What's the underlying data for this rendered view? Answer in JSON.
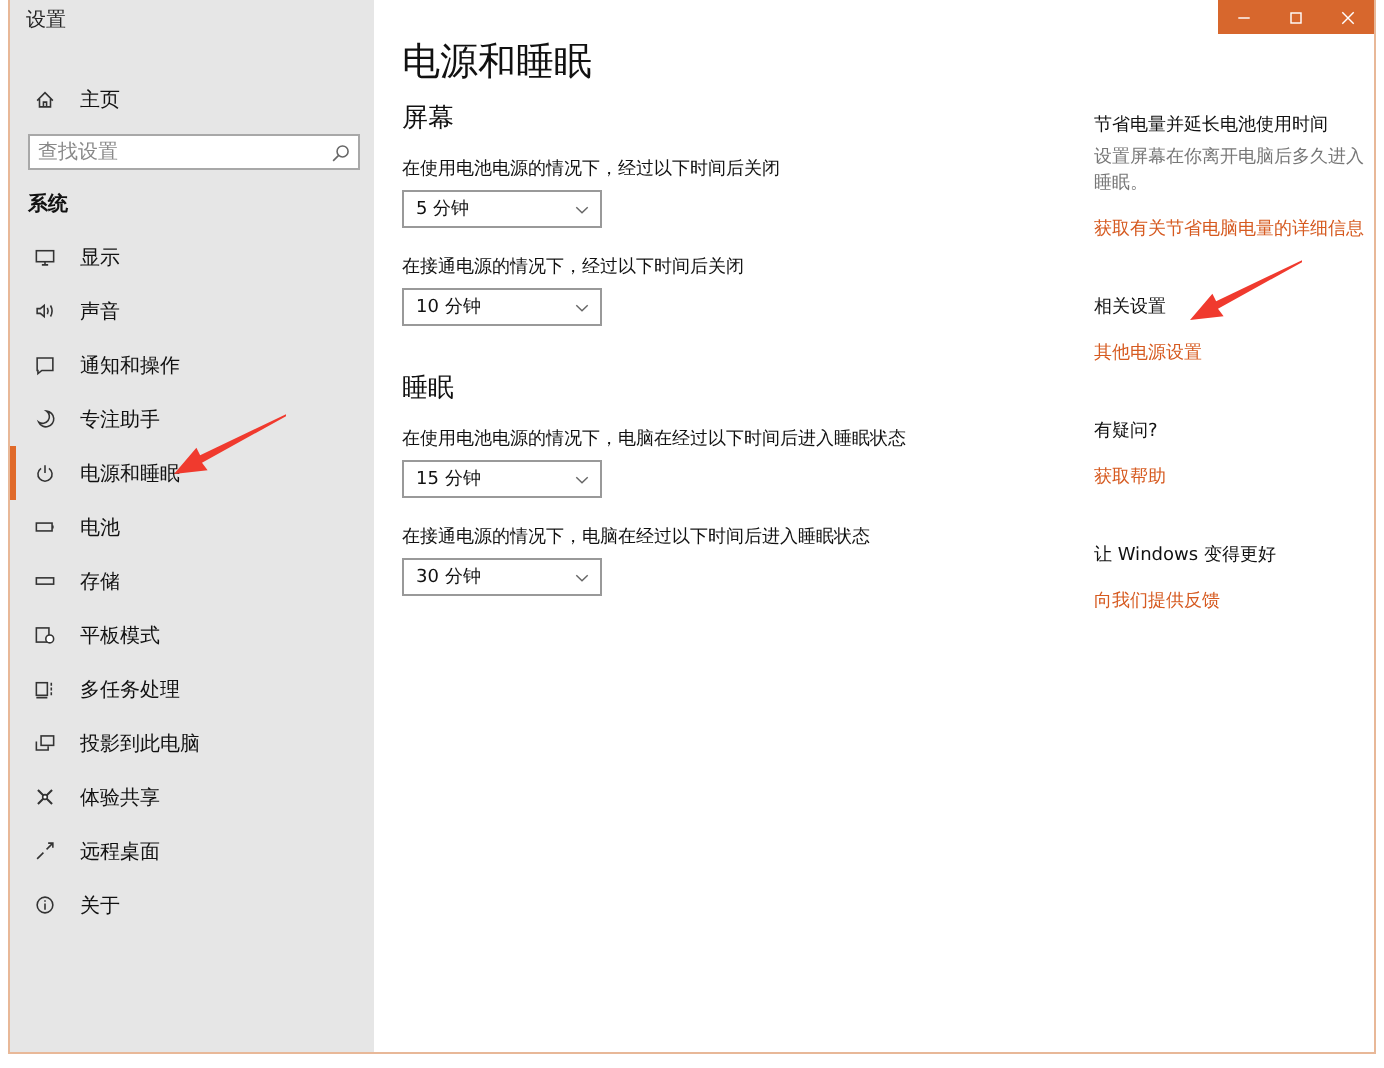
{
  "window": {
    "title": "设置",
    "controls": [
      {
        "kind": "minimize"
      },
      {
        "kind": "maximize"
      },
      {
        "kind": "close"
      }
    ]
  },
  "sidebar": {
    "home": {
      "label": "主页",
      "kind": "home"
    },
    "search": {
      "placeholder": "查找设置"
    },
    "section": "系统",
    "items": [
      {
        "label": "显示",
        "kind": "display",
        "selected": false
      },
      {
        "label": "声音",
        "kind": "sound",
        "selected": false
      },
      {
        "label": "通知和操作",
        "kind": "notify",
        "selected": false
      },
      {
        "label": "专注助手",
        "kind": "moon",
        "selected": false
      },
      {
        "label": "电源和睡眠",
        "kind": "power",
        "selected": true
      },
      {
        "label": "电池",
        "kind": "battery",
        "selected": false
      },
      {
        "label": "存储",
        "kind": "storage",
        "selected": false
      },
      {
        "label": "平板模式",
        "kind": "tablet",
        "selected": false
      },
      {
        "label": "多任务处理",
        "kind": "multitask",
        "selected": false
      },
      {
        "label": "投影到此电脑",
        "kind": "project",
        "selected": false
      },
      {
        "label": "体验共享",
        "kind": "share",
        "selected": false
      },
      {
        "label": "远程桌面",
        "kind": "remote",
        "selected": false
      },
      {
        "label": "关于",
        "kind": "info",
        "selected": false
      }
    ]
  },
  "main": {
    "title": "电源和睡眠",
    "sections": [
      {
        "heading": "屏幕",
        "settings": [
          {
            "label": "在使用电池电源的情况下，经过以下时间后关闭",
            "value": "5 分钟"
          },
          {
            "label": "在接通电源的情况下，经过以下时间后关闭",
            "value": "10 分钟"
          }
        ]
      },
      {
        "heading": "睡眠",
        "settings": [
          {
            "label": "在使用电池电源的情况下，电脑在经过以下时间后进入睡眠状态",
            "value": "15 分钟"
          },
          {
            "label": "在接通电源的情况下，电脑在经过以下时间后进入睡眠状态",
            "value": "30 分钟"
          }
        ]
      }
    ]
  },
  "aside": [
    {
      "heading": "节省电量并延长电池使用时间",
      "text": "设置屏幕在你离开电脑后多久进入睡眠。",
      "links": [
        "获取有关节省电脑电量的详细信息"
      ]
    },
    {
      "heading": "相关设置",
      "links": [
        "其他电源设置"
      ]
    },
    {
      "heading": "有疑问?",
      "links": [
        "获取帮助"
      ]
    },
    {
      "heading": "让 Windows 变得更好",
      "links": [
        "向我们提供反馈"
      ]
    }
  ],
  "annotations": [
    {
      "kind": "arrow"
    },
    {
      "kind": "arrow"
    }
  ]
}
